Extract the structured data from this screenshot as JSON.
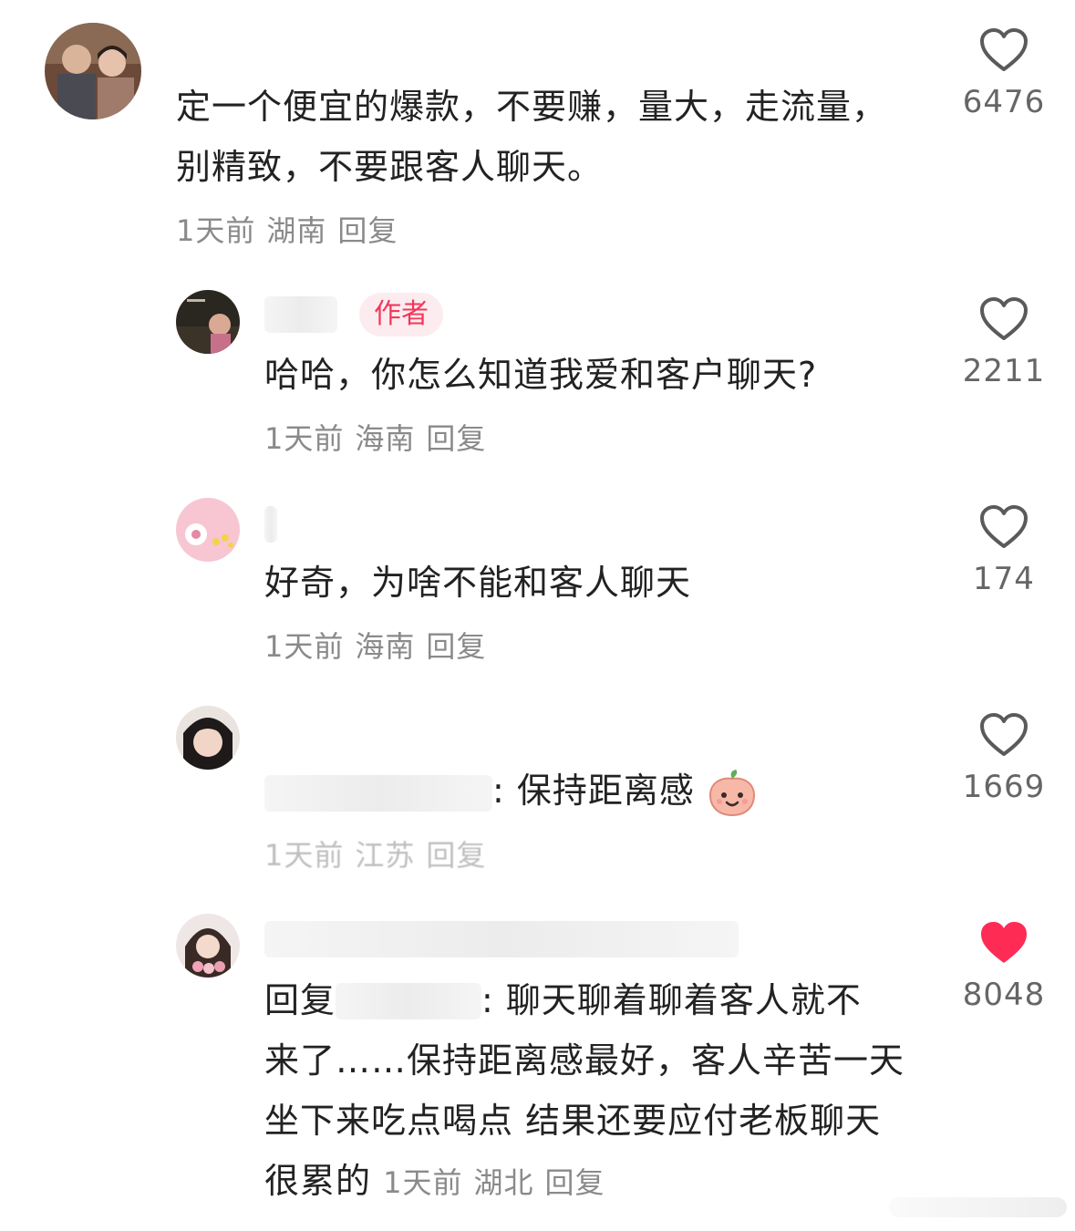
{
  "comments": [
    {
      "text": "定一个便宜的爆款，不要赚，量大，走流量，别精致，不要跟客人聊天。",
      "time": "1天前",
      "location": "湖南",
      "reply_label": "回复",
      "likes": "6476"
    },
    {
      "badge": "作者",
      "text": "哈哈，你怎么知道我爱和客户聊天?",
      "time": "1天前",
      "location": "海南",
      "reply_label": "回复",
      "likes": "2211"
    },
    {
      "text": "好奇，为啥不能和客人聊天",
      "time": "1天前",
      "location": "海南",
      "reply_label": "回复",
      "likes": "174"
    },
    {
      "text": ": 保持距离感",
      "time": "1天前",
      "location": "江苏",
      "reply_label": "回复",
      "likes": "1669"
    },
    {
      "reply_prefix": "回复",
      "text_line1": ": 聊天聊着聊着客人就不",
      "text_rest": "来了……保持距离感最好，客人辛苦一天坐下来吃点喝点 结果还要应付老板聊天 很累的",
      "time": "1天前",
      "location": "湖北",
      "reply_label": "回复",
      "likes": "8048"
    }
  ],
  "colors": {
    "liked_heart": "#fe2c55",
    "author_badge_text": "#f2375a",
    "author_badge_bg": "#fdecef",
    "meta_gray": "#8a8a8a"
  },
  "icons": {
    "like": "heart-outline-icon",
    "liked": "heart-filled-icon",
    "emoji": "peach-smile-emoji-icon"
  }
}
